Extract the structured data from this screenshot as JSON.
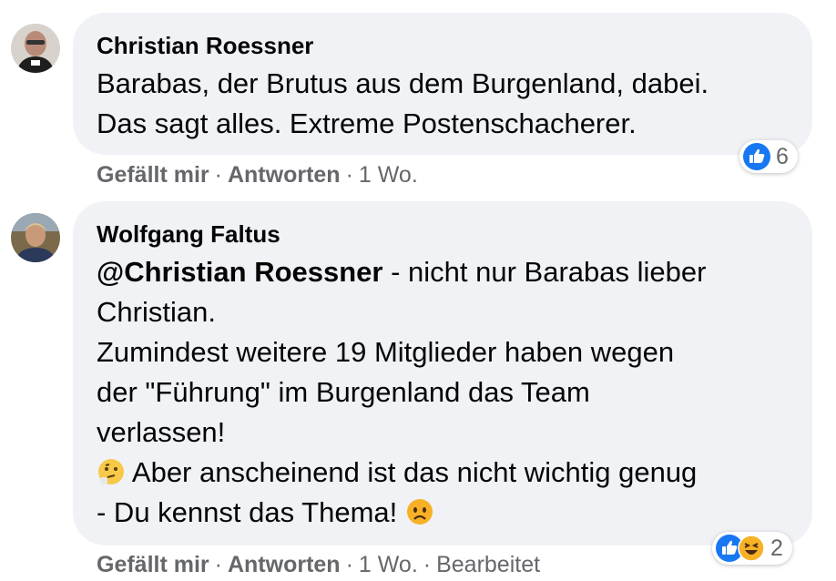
{
  "comments": [
    {
      "author": "Christian Roessner",
      "text": "Barabas, der Brutus aus dem Burgenland, dabei.\nDas sagt alles. Extreme Postenschacherer.",
      "reaction_count": "6",
      "actions": {
        "like": "Gefällt mir",
        "reply": "Antworten",
        "time": "1 Wo.",
        "edited": ""
      }
    },
    {
      "author": "Wolfgang Faltus",
      "mention": "@Christian Roessner",
      "text_line1_rest": " - nicht nur Barabas lieber",
      "text_line2": "Christian.",
      "text_line3": "Zumindest weitere 19 Mitglieder haben wegen",
      "text_line4": "der \"Führung\" im Burgenland das Team",
      "text_line5": "verlassen!",
      "text_line6": " Aber anscheinend ist das nicht wichtig genug",
      "text_line7": "- Du kennst das Thema! ",
      "reaction_count": "2",
      "actions": {
        "like": "Gefällt mir",
        "reply": "Antworten",
        "time": "1 Wo.",
        "edited": "Bearbeitet"
      }
    }
  ],
  "icons": {
    "like_color": "#1877f2",
    "haha_color": "#f7b125"
  }
}
